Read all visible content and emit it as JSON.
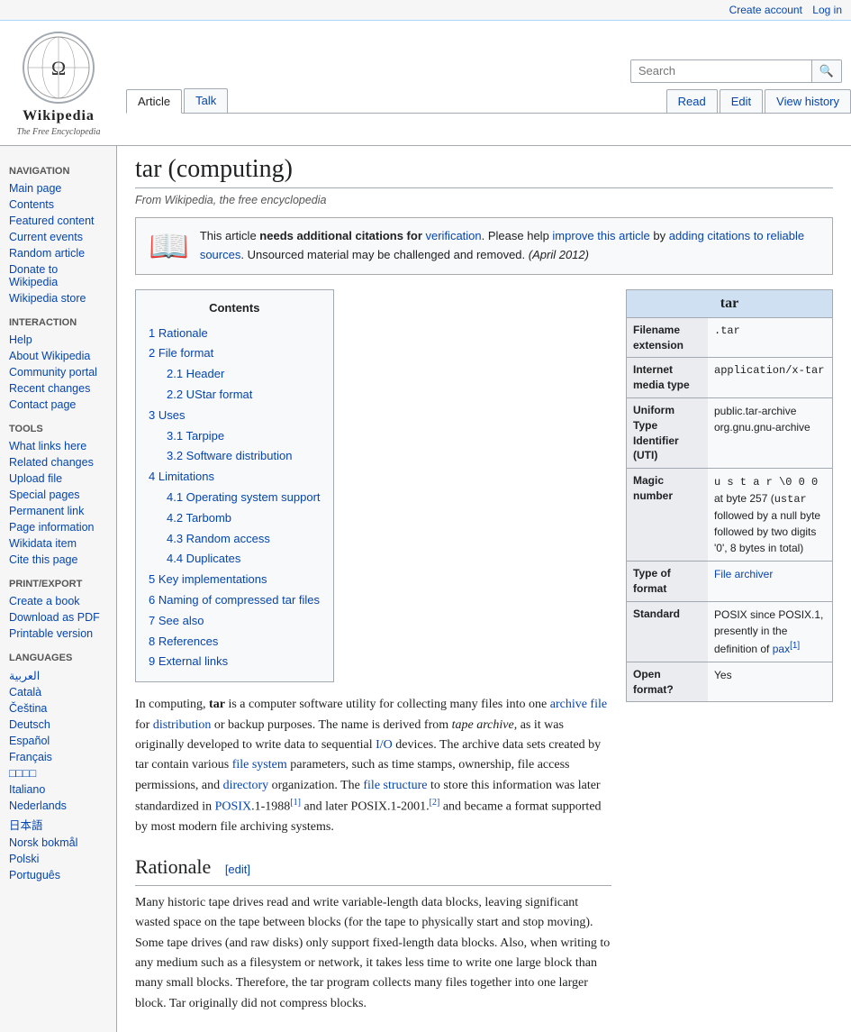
{
  "topbar": {
    "create_account": "Create account",
    "log_in": "Log in"
  },
  "logo": {
    "title": "Wikipedia",
    "subtitle": "The Free Encyclopedia",
    "globe_char": "🌐"
  },
  "tabs": {
    "article": "Article",
    "talk": "Talk",
    "read": "Read",
    "edit": "Edit",
    "view_history": "View history"
  },
  "search": {
    "placeholder": "Search",
    "button_char": "🔍"
  },
  "sidebar": {
    "navigation_label": "Navigation",
    "items_nav": [
      {
        "label": "Main page",
        "id": "main-page"
      },
      {
        "label": "Contents",
        "id": "contents"
      },
      {
        "label": "Featured content",
        "id": "featured-content"
      },
      {
        "label": "Current events",
        "id": "current-events"
      },
      {
        "label": "Random article",
        "id": "random-article"
      },
      {
        "label": "Donate to Wikipedia",
        "id": "donate"
      },
      {
        "label": "Wikipedia store",
        "id": "wiki-store"
      }
    ],
    "interaction_label": "Interaction",
    "items_interaction": [
      {
        "label": "Help",
        "id": "help"
      },
      {
        "label": "About Wikipedia",
        "id": "about"
      },
      {
        "label": "Community portal",
        "id": "community-portal"
      },
      {
        "label": "Recent changes",
        "id": "recent-changes"
      },
      {
        "label": "Contact page",
        "id": "contact"
      }
    ],
    "tools_label": "Tools",
    "items_tools": [
      {
        "label": "What links here",
        "id": "what-links"
      },
      {
        "label": "Related changes",
        "id": "related-changes"
      },
      {
        "label": "Upload file",
        "id": "upload-file"
      },
      {
        "label": "Special pages",
        "id": "special-pages"
      },
      {
        "label": "Permanent link",
        "id": "permanent-link"
      },
      {
        "label": "Page information",
        "id": "page-info"
      },
      {
        "label": "Wikidata item",
        "id": "wikidata"
      },
      {
        "label": "Cite this page",
        "id": "cite"
      }
    ],
    "print_label": "Print/export",
    "items_print": [
      {
        "label": "Create a book",
        "id": "create-book"
      },
      {
        "label": "Download as PDF",
        "id": "download-pdf"
      },
      {
        "label": "Printable version",
        "id": "printable"
      }
    ],
    "languages_label": "Languages",
    "items_languages": [
      {
        "label": "العربية"
      },
      {
        "label": "Català"
      },
      {
        "label": "Čeština"
      },
      {
        "label": "Deutsch"
      },
      {
        "label": "Español"
      },
      {
        "label": "Français"
      },
      {
        "label": "□□□□"
      },
      {
        "label": "Italiano"
      },
      {
        "label": "Nederlands"
      },
      {
        "label": "日本語"
      },
      {
        "label": "Norsk bokmål"
      },
      {
        "label": "Polski"
      },
      {
        "label": "Português"
      }
    ]
  },
  "page": {
    "title": "tar (computing)",
    "subtitle": "From Wikipedia, the free encyclopedia"
  },
  "notice": {
    "icon": "📖",
    "text_parts": [
      "This article ",
      "needs additional citations for",
      " ",
      "verification",
      ". Please help ",
      "improve this article",
      " by ",
      "adding citations to reliable sources",
      ". Unsourced material may be challenged and removed.",
      " (April 2012)"
    ],
    "bold_phrase": "needs additional citations for",
    "link1": "verification",
    "link2": "improve this article",
    "link3": "adding citations to reliable sources",
    "date": "(April 2012)"
  },
  "infobox": {
    "title": "tar",
    "rows": [
      {
        "label": "Filename extension",
        "value": ".tar",
        "monospace": true
      },
      {
        "label": "Internet media type",
        "value": "application/x-tar",
        "monospace": true
      },
      {
        "label": "Uniform Type Identifier (UTI)",
        "value": "public.tar-archive\norg.gnu.gnu-archive",
        "monospace": false
      },
      {
        "label": "Magic number",
        "value": "u s t a r \\0 0 0 at byte 257 (ustar followed by a null byte followed by two digits '0', 8 bytes in total)",
        "monospace": false
      },
      {
        "label": "Type of format",
        "value": "File archiver",
        "link": true
      },
      {
        "label": "Standard",
        "value": "POSIX since POSIX.1, presently in the definition of pax[1]",
        "monospace": false
      },
      {
        "label": "Open format?",
        "value": "Yes"
      }
    ]
  },
  "article_intro": {
    "p1_parts": [
      "In computing, ",
      "tar",
      " is a computer software utility for collecting many files into one ",
      "archive file",
      " for ",
      "distribution",
      " or backup purposes. The name is derived from ",
      "tape archive",
      ", as it was originally developed to write data to sequential ",
      "I/O",
      " devices. The archive data sets created by tar contain various ",
      "file system",
      " parameters, such as time stamps, ownership, file access permissions, and ",
      "directory",
      " organization. The ",
      "file structure",
      " to store this information was later standardized in ",
      "POSIX",
      ".1-1988",
      "[1]",
      " and later POSIX.1-2001.",
      "[2]",
      " and became a format supported by most modern file archiving systems."
    ]
  },
  "toc": {
    "title": "Contents",
    "items": [
      {
        "num": "1",
        "label": "Rationale",
        "id": "rationale"
      },
      {
        "num": "2",
        "label": "File format",
        "id": "file-format"
      },
      {
        "num": "2.1",
        "label": "Header",
        "id": "header",
        "sub": true
      },
      {
        "num": "2.2",
        "label": "UStar format",
        "id": "ustar",
        "sub": true
      },
      {
        "num": "3",
        "label": "Uses",
        "id": "uses"
      },
      {
        "num": "3.1",
        "label": "Tarpipe",
        "id": "tarpipe",
        "sub": true
      },
      {
        "num": "3.2",
        "label": "Software distribution",
        "id": "software-dist",
        "sub": true
      },
      {
        "num": "4",
        "label": "Limitations",
        "id": "limitations"
      },
      {
        "num": "4.1",
        "label": "Operating system support",
        "id": "os-support",
        "sub": true
      },
      {
        "num": "4.2",
        "label": "Tarbomb",
        "id": "tarbomb",
        "sub": true
      },
      {
        "num": "4.3",
        "label": "Random access",
        "id": "random-access",
        "sub": true
      },
      {
        "num": "4.4",
        "label": "Duplicates",
        "id": "duplicates",
        "sub": true
      },
      {
        "num": "5",
        "label": "Key implementations",
        "id": "key-impl"
      },
      {
        "num": "6",
        "label": "Naming of compressed tar files",
        "id": "naming"
      },
      {
        "num": "7",
        "label": "See also",
        "id": "see-also"
      },
      {
        "num": "8",
        "label": "References",
        "id": "references"
      },
      {
        "num": "9",
        "label": "External links",
        "id": "ext-links"
      }
    ]
  },
  "rationale_section": {
    "heading": "Rationale",
    "edit_label": "[edit]",
    "text": "Many historic tape drives read and write variable-length data blocks, leaving significant wasted space on the tape between blocks (for the tape to physically start and stop moving). Some tape drives (and raw disks) only support fixed-length data blocks. Also, when writing to any medium such as a filesystem or network, it takes less time to write one large block than many small blocks. Therefore, the tar program collects many files together into one larger block. Tar originally did not compress blocks."
  }
}
